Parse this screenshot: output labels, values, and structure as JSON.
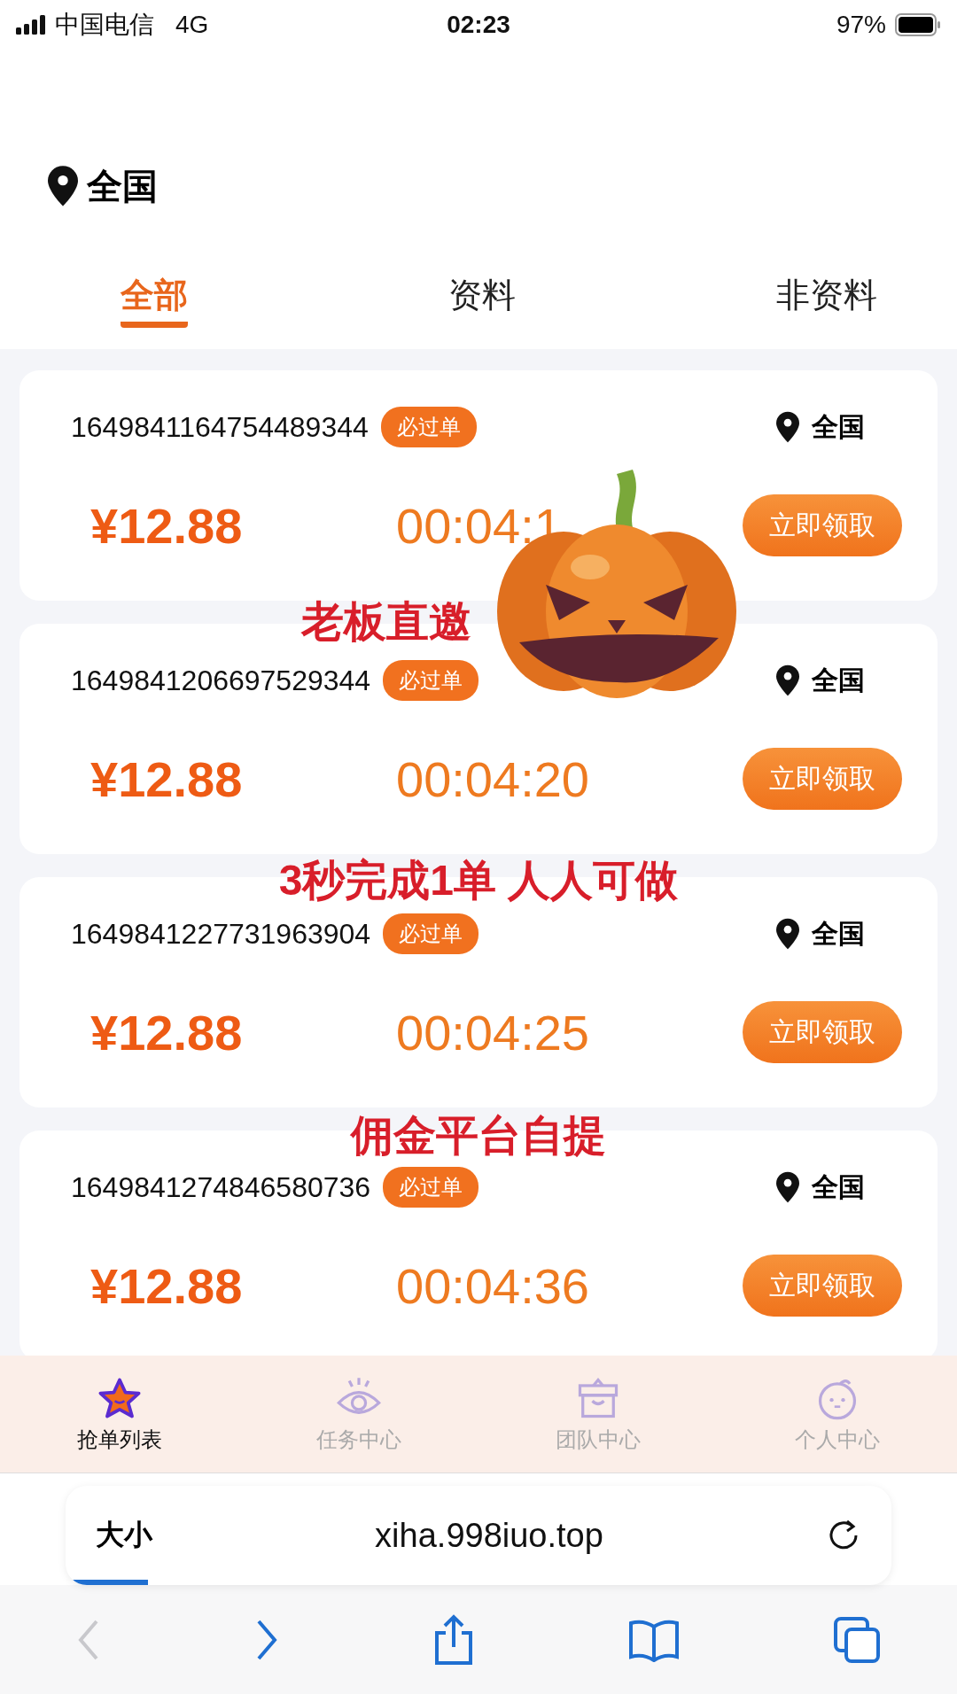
{
  "status_bar": {
    "carrier": "中国电信",
    "network": "4G",
    "time": "02:23",
    "battery": "97%"
  },
  "location": {
    "label": "全国"
  },
  "tabs": [
    {
      "label": "全部",
      "selected": true
    },
    {
      "label": "资料",
      "selected": false
    },
    {
      "label": "非资料",
      "selected": false
    }
  ],
  "orders": [
    {
      "id": "1649841164754489344",
      "badge": "必过单",
      "region": "全国",
      "price": "¥12.88",
      "timer": "00:04:1",
      "button": "立即领取"
    },
    {
      "id": "1649841206697529344",
      "badge": "必过单",
      "region": "全国",
      "price": "¥12.88",
      "timer": "00:04:20",
      "button": "立即领取"
    },
    {
      "id": "1649841227731963904",
      "badge": "必过单",
      "region": "全国",
      "price": "¥12.88",
      "timer": "00:04:25",
      "button": "立即领取"
    },
    {
      "id": "1649841274846580736",
      "badge": "必过单",
      "region": "全国",
      "price": "¥12.88",
      "timer": "00:04:36",
      "button": "立即领取"
    }
  ],
  "overlay_texts": [
    "老板直邀",
    "3秒完成1单 人人可做",
    "佣金平台自提"
  ],
  "bottom_nav": [
    {
      "label": "抢单列表",
      "kind": "star",
      "selected": true
    },
    {
      "label": "任务中心",
      "kind": "eye",
      "selected": false
    },
    {
      "label": "团队中心",
      "kind": "box",
      "selected": false
    },
    {
      "label": "个人中心",
      "kind": "face",
      "selected": false
    }
  ],
  "browser": {
    "text_size": "大小",
    "url": "xiha.998iuo.top",
    "progress": {
      "level": 0.1
    }
  }
}
